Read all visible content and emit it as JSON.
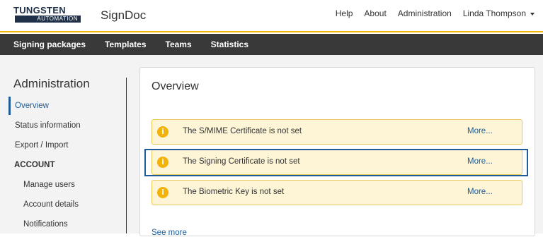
{
  "header": {
    "logo_top": "TUNGSTEN",
    "logo_bottom": "AUTOMATION",
    "app_name": "SignDoc",
    "links": {
      "help": "Help",
      "about": "About",
      "administration": "Administration",
      "user": "Linda Thompson"
    }
  },
  "mainnav": {
    "items": [
      "Signing packages",
      "Templates",
      "Teams",
      "Statistics"
    ]
  },
  "sidebar": {
    "title": "Administration",
    "items": [
      "Overview",
      "Status information",
      "Export / Import"
    ],
    "section_heading": "ACCOUNT",
    "sub_items": [
      "Manage users",
      "Account details",
      "Notifications"
    ]
  },
  "panel": {
    "title": "Overview",
    "alerts": [
      {
        "text": "The S/MIME Certificate is not set",
        "more": "More..."
      },
      {
        "text": "The Signing Certificate is not set",
        "more": "More..."
      },
      {
        "text": "The Biometric Key is not set",
        "more": "More..."
      }
    ],
    "alert_icon_glyph": "i",
    "see_more": "See more"
  },
  "colors": {
    "accent": "#1f5c99",
    "nav_bg": "#393939",
    "header_border": "#f0b400",
    "alert_bg": "#fdf5d6",
    "alert_border": "#e8c859",
    "alert_icon": "#f3b20a"
  }
}
